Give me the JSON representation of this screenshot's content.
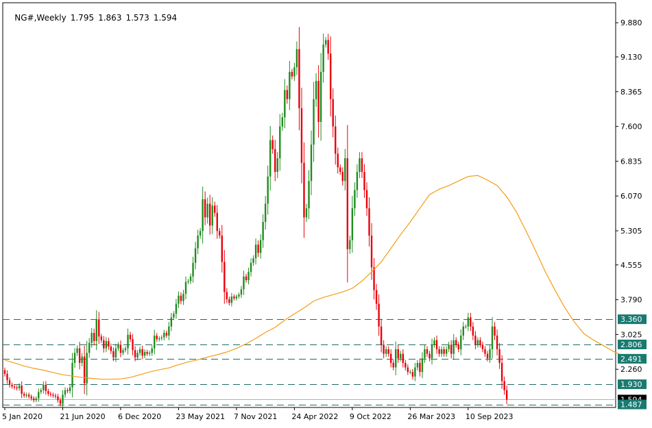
{
  "header": {
    "symbol": "NG#,Weekly",
    "open": "1.795",
    "high": "1.863",
    "low": "1.573",
    "close": "1.594"
  },
  "colors": {
    "up": "#1e8c1e",
    "down": "#e8000b",
    "ma": "#f39c12",
    "level": "#1c6b63",
    "badge": "#197a70",
    "current_badge": "#000000",
    "frame": "#000000"
  },
  "chart_data": {
    "type": "candlestick",
    "title": "NG#,Weekly",
    "ylim": [
      1.42,
      10.32
    ],
    "y_ticks": [
      "9.880",
      "9.130",
      "8.365",
      "7.600",
      "6.835",
      "6.070",
      "5.305",
      "4.555",
      "3.790",
      "3.025",
      "2.260"
    ],
    "x_ticks": [
      "5 Jan 2020",
      "21 Jun 2020",
      "6 Dec 2020",
      "23 May 2021",
      "7 Nov 2021",
      "24 Apr 2022",
      "9 Oct 2022",
      "26 Mar 2023",
      "10 Sep 2023"
    ],
    "x_tick_weeks": [
      0,
      24,
      48,
      72,
      96,
      120,
      144,
      168,
      192
    ],
    "levels": [
      {
        "label": "3.360",
        "value": 3.36
      },
      {
        "label": "2.806",
        "value": 2.806
      },
      {
        "label": "2.491",
        "value": 2.491
      },
      {
        "label": "1.930",
        "value": 1.93
      },
      {
        "label": "1.487",
        "value": 1.487
      }
    ],
    "current_price": {
      "label": "1.594",
      "value": 1.594
    },
    "close_series_weekly": [
      2.16,
      2.02,
      1.92,
      1.88,
      1.86,
      1.84,
      1.9,
      1.72,
      1.68,
      1.7,
      1.66,
      1.62,
      1.58,
      1.62,
      1.76,
      1.8,
      1.92,
      1.78,
      1.72,
      1.7,
      1.68,
      1.66,
      1.58,
      1.5,
      1.7,
      1.8,
      1.78,
      1.86,
      2.4,
      2.62,
      2.72,
      2.4,
      2.54,
      1.95,
      2.62,
      2.84,
      3.06,
      2.88,
      3.36,
      2.98,
      2.9,
      2.72,
      2.88,
      2.76,
      2.66,
      2.52,
      2.72,
      2.8,
      2.62,
      2.68,
      2.72,
      3.02,
      2.92,
      2.68,
      2.52,
      2.62,
      2.7,
      2.56,
      2.64,
      2.6,
      2.62,
      2.72,
      3.0,
      2.92,
      2.94,
      2.96,
      3.06,
      3.0,
      3.2,
      3.4,
      3.48,
      3.7,
      3.88,
      3.76,
      3.92,
      4.18,
      4.2,
      4.3,
      4.6,
      4.92,
      5.2,
      5.3,
      6.0,
      5.6,
      5.9,
      5.42,
      5.86,
      5.7,
      5.3,
      5.2,
      4.62,
      3.96,
      3.8,
      3.72,
      3.86,
      3.82,
      3.86,
      3.9,
      4.02,
      4.3,
      4.22,
      4.4,
      4.6,
      4.7,
      5.0,
      4.82,
      5.1,
      5.5,
      5.9,
      6.5,
      7.3,
      7.1,
      6.6,
      6.9,
      7.6,
      7.8,
      8.4,
      8.2,
      8.8,
      8.7,
      8.9,
      9.3,
      8.0,
      6.8,
      5.6,
      5.8,
      6.4,
      7.2,
      8.2,
      8.6,
      7.7,
      8.8,
      9.4,
      9.5,
      9.2,
      8.2,
      7.6,
      7.0,
      6.7,
      6.6,
      6.4,
      6.9,
      4.9,
      5.1,
      5.8,
      6.2,
      6.6,
      6.9,
      6.6,
      6.2,
      5.8,
      5.2,
      4.5,
      4.0,
      3.7,
      3.2,
      2.8,
      2.6,
      2.7,
      2.6,
      2.4,
      2.3,
      2.7,
      2.5,
      2.6,
      2.4,
      2.3,
      2.2,
      2.2,
      2.1,
      2.3,
      2.4,
      2.2,
      2.5,
      2.7,
      2.6,
      2.5,
      2.8,
      2.9,
      2.7,
      2.6,
      2.7,
      2.6,
      2.7,
      2.8,
      2.6,
      2.9,
      2.8,
      2.7,
      3.0,
      3.2,
      3.2,
      3.4,
      3.2,
      3.0,
      2.8,
      2.9,
      2.8,
      2.7,
      2.6,
      2.5,
      2.7,
      3.2,
      3.0,
      2.7,
      2.4,
      2.0,
      1.8,
      1.594
    ],
    "ma_series": [
      2.46,
      2.4,
      2.33,
      2.28,
      2.24,
      2.19,
      2.14,
      2.11,
      2.08,
      2.06,
      2.04,
      2.04,
      2.05,
      2.08,
      2.14,
      2.2,
      2.25,
      2.29,
      2.36,
      2.42,
      2.47,
      2.53,
      2.58,
      2.64,
      2.72,
      2.82,
      2.94,
      3.07,
      3.18,
      3.34,
      3.48,
      3.61,
      3.76,
      3.84,
      3.9,
      3.96,
      4.04,
      4.2,
      4.4,
      4.62,
      4.92,
      5.22,
      5.5,
      5.8,
      6.1,
      6.22,
      6.3,
      6.4,
      6.5,
      6.52,
      6.42,
      6.3,
      6.05,
      5.72,
      5.3,
      4.86,
      4.4,
      4.0,
      3.62,
      3.3,
      3.04,
      2.9,
      2.78,
      2.66,
      2.56
    ],
    "ma_weeks": [
      0,
      4,
      8,
      12,
      16,
      20,
      24,
      28,
      32,
      36,
      40,
      44,
      48,
      52,
      56,
      60,
      64,
      68,
      72,
      76,
      80,
      84,
      88,
      92,
      96,
      100,
      104,
      108,
      112,
      116,
      120,
      124,
      128,
      132,
      136,
      140,
      144,
      148,
      152,
      156,
      160,
      164,
      168,
      172,
      176,
      180,
      184,
      188,
      192,
      196,
      200,
      204,
      208,
      212,
      216,
      220,
      224,
      228,
      232,
      236,
      240,
      244,
      248,
      252,
      256
    ]
  }
}
